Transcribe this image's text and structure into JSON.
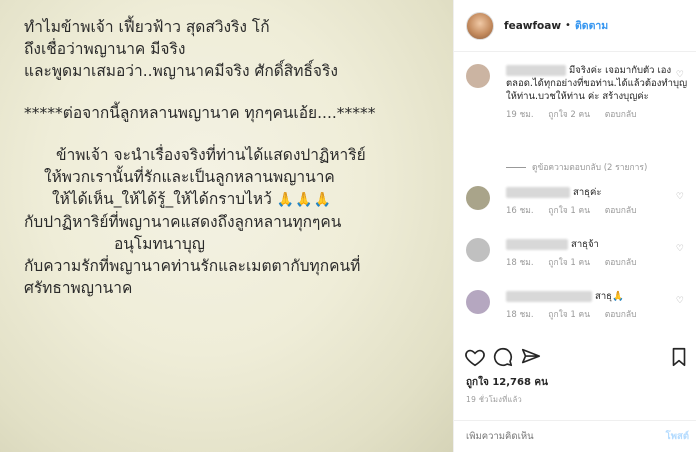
{
  "post_image": {
    "lines": [
      "ทำไมข้าพเจ้า เฟี้ยวฟ้าว สุดสวิงริง โก้",
      "ถึงเชื่อว่าพญานาค มีจริง",
      "และพูดมาเสมอว่า..พญานาคมีจริง ศักดิ์สิทธิ์จริง",
      "*****ต่อจากนี้ลูกหลานพญานาค ทุกๆคนเอ้ย....*****",
      "ข้าพเจ้า จะนำเรื่องจริงที่ท่านได้แสดงปาฏิหาริย์",
      "ให้พวกเรานั้นที่รักและเป็นลูกหลานพญานาค",
      "ให้ได้เห็น_ให้ได้รู้_ให้ได้กราบไหว้",
      "กับปาฏิหาริย์ที่พญานาคแสดงถึงลูกหลานทุกๆคน",
      "อนุโมทนาบุญ",
      "กับความรักที่พญานาคท่านรักและเมตตากับทุกคนที่",
      "ศรัทธาพญานาค"
    ],
    "emoji": "🙏🙏🙏"
  },
  "header": {
    "username": "feawfoaw",
    "dot": "•",
    "follow_label": "ติดตาม"
  },
  "comments": [
    {
      "text": "มีจริงค่ะ เจอมากับตัว เองตลอด.ได้ทุกอย่างที่ขอท่าน.ได้แล้วต้องทำบุญ ให้ท่าน.บวชให้ท่าน ค่ะ สร้างบุญค่ะ",
      "time": "19 ชม.",
      "likes": "ถูกใจ 2 คน",
      "reply": "ตอบกลับ"
    },
    {
      "text": "สาธุค่ะ",
      "time": "16 ชม.",
      "likes": "ถูกใจ 1 คน",
      "reply": "ตอบกลับ"
    },
    {
      "text": "สาธุจ้า",
      "time": "18 ชม.",
      "likes": "ถูกใจ 1 คน",
      "reply": "ตอบกลับ"
    },
    {
      "text": "สาธุ🙏",
      "time": "18 ชม.",
      "likes": "ถูกใจ 1 คน",
      "reply": "ตอบกลับ"
    }
  ],
  "view_replies": "ดูข้อความตอบกลับ (2 รายการ)",
  "likes_count": "ถูกใจ 12,768 คน",
  "post_time": "19 ชั่วโมงที่แล้ว",
  "add_comment": {
    "placeholder": "เพิ่มความคิดเห็น",
    "post_label": "โพสต์"
  }
}
